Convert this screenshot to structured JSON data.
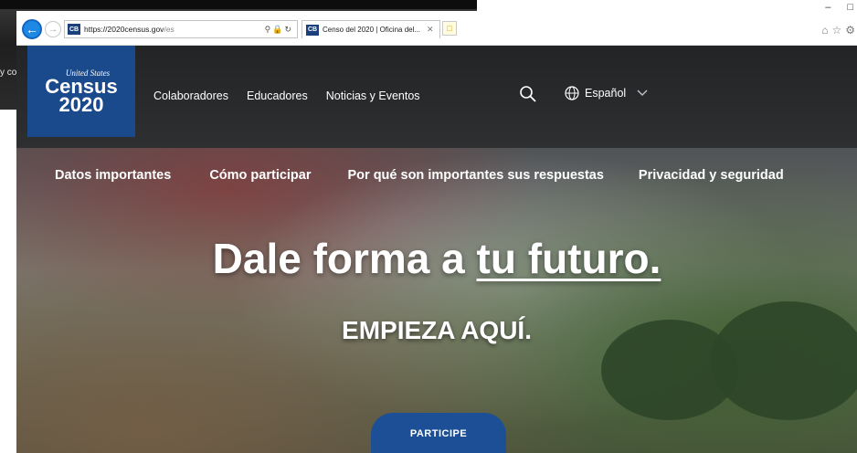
{
  "background_window": {
    "partial_text": "y co"
  },
  "browser": {
    "url_host": "https://2020census.gov",
    "url_path": "/es",
    "favicon_text": "CB",
    "tab_title": "Censo del 2020 | Oficina del...",
    "window_controls": [
      "–",
      "□"
    ]
  },
  "site": {
    "logo": {
      "top": "United States",
      "name": "Census",
      "year": "2020"
    },
    "util_nav": [
      "Colaboradores",
      "Educadores",
      "Noticias y Eventos"
    ],
    "language": "Español",
    "main_nav": [
      "Datos importantes",
      "Cómo participar",
      "Por qué son importantes sus respuestas",
      "Privacidad y seguridad"
    ],
    "hero": {
      "title_before": "Dale forma a ",
      "title_link": "tu futuro.",
      "subtitle": "EMPIEZA AQUÍ.",
      "cta": "PARTICIPE"
    }
  },
  "colors": {
    "brand_blue": "#1b4a8c",
    "cta_blue": "#1c4f95",
    "back_button": "#1e88e5"
  },
  "icons": [
    "back-arrow-icon",
    "forward-arrow-icon",
    "search-icon",
    "lock-icon",
    "refresh-icon",
    "close-icon",
    "new-tab-icon",
    "home-icon",
    "star-icon",
    "gear-icon",
    "globe-icon",
    "chevron-down-icon"
  ]
}
